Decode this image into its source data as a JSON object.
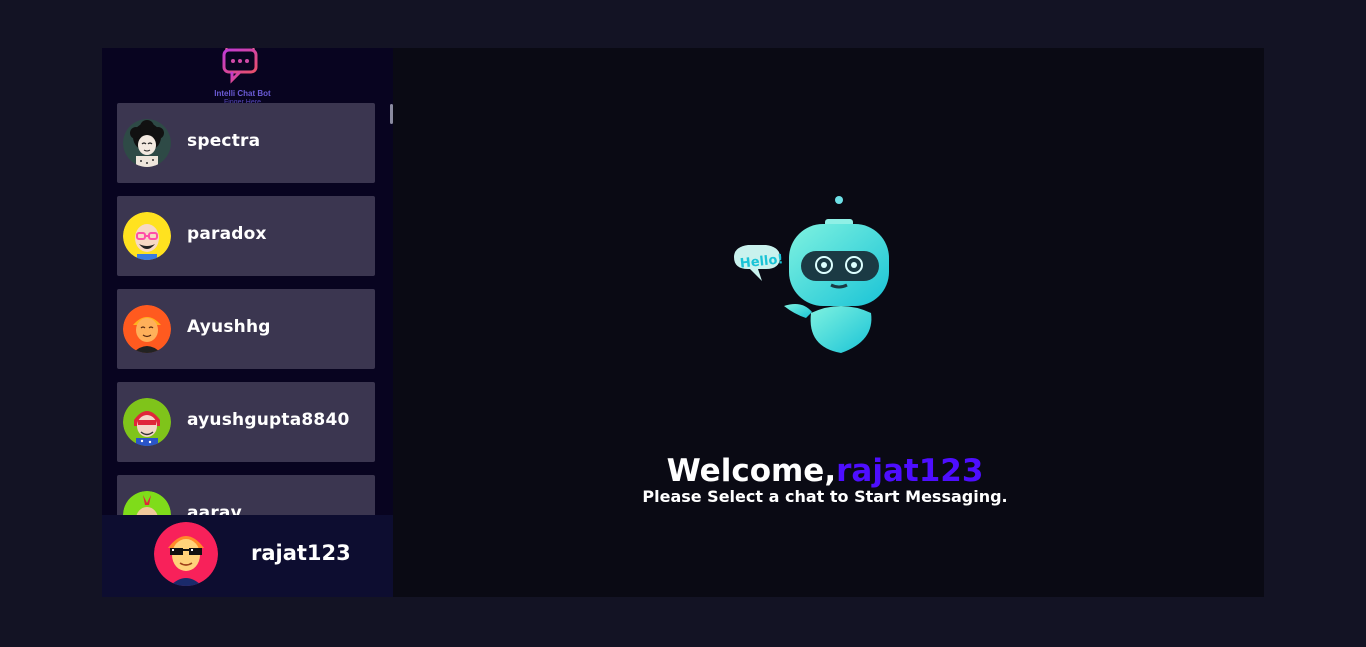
{
  "brand": {
    "title": "Intelli Chat Bot",
    "subtitle": "Finger Here",
    "logo_icon": "chat-bot-icon"
  },
  "contacts": [
    {
      "name": "spectra",
      "avatar": "avatar-curly-hair-icon"
    },
    {
      "name": "paradox",
      "avatar": "avatar-pink-glasses-icon"
    },
    {
      "name": "Ayushhg",
      "avatar": "avatar-orange-icon"
    },
    {
      "name": "ayushgupta8840",
      "avatar": "avatar-red-hair-icon"
    },
    {
      "name": "aarav",
      "avatar": "avatar-mohawk-icon"
    }
  ],
  "current_user": {
    "name": "rajat123",
    "avatar": "avatar-sunglasses-icon"
  },
  "welcome": {
    "greeting": "Welcome,",
    "username": "rajat123",
    "prompt": "Please Select a chat to Start Messaging.",
    "robot_bubble": "Hello!"
  },
  "colors": {
    "page_bg": "#131324",
    "sidebar_bg": "#080420",
    "contact_bg": "#3b3650",
    "current_user_bg": "#0d0d30",
    "accent": "#4e0eff"
  }
}
